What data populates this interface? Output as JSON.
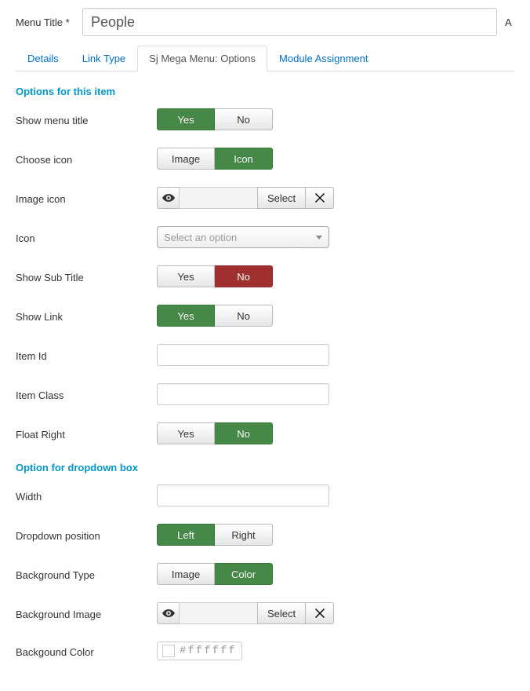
{
  "top": {
    "label": "Menu Title *",
    "value": "People",
    "side": "A"
  },
  "tabs": [
    {
      "label": "Details"
    },
    {
      "label": "Link Type"
    },
    {
      "label": "Sj Mega Menu: Options"
    },
    {
      "label": "Module Assignment"
    }
  ],
  "section1_title": "Options for this item",
  "labels": {
    "show_menu_title": "Show menu title",
    "choose_icon": "Choose icon",
    "image_icon": "Image icon",
    "icon": "Icon",
    "show_sub_title": "Show Sub Title",
    "show_link": "Show Link",
    "item_id": "Item Id",
    "item_class": "Item Class",
    "float_right": "Float Right"
  },
  "section2_title": "Option for dropdown box",
  "labels2": {
    "width": "Width",
    "dropdown_position": "Dropdown position",
    "background_type": "Background Type",
    "background_image": "Background Image",
    "background_color": "Backgound Color"
  },
  "btn": {
    "yes": "Yes",
    "no": "No",
    "image": "Image",
    "icon": "Icon",
    "left": "Left",
    "right": "Right",
    "color": "Color",
    "select": "Select"
  },
  "icon_placeholder": "Select an option",
  "color_value": "#ffffff",
  "values": {
    "image_icon": "",
    "item_id": "",
    "item_class": "",
    "width": "",
    "background_image": ""
  },
  "state": {
    "show_menu_title": "yes",
    "choose_icon": "icon",
    "show_sub_title": "no",
    "show_link": "yes",
    "float_right": "no",
    "dropdown_position": "left",
    "background_type": "color"
  }
}
